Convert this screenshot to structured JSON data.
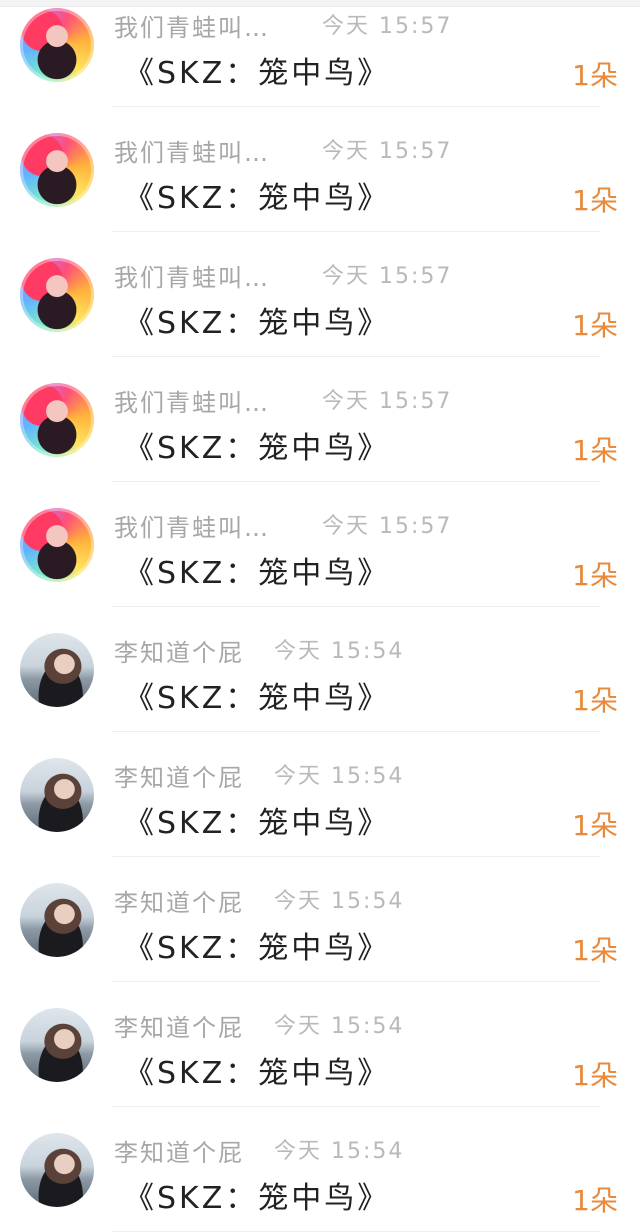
{
  "gift_list": {
    "rows": [
      {
        "name": "我们青蛙叫…",
        "time": "今天 15:57",
        "gift": "《SKZ：笼中鸟》",
        "count": "1朵"
      },
      {
        "name": "我们青蛙叫…",
        "time": "今天 15:57",
        "gift": "《SKZ：笼中鸟》",
        "count": "1朵"
      },
      {
        "name": "我们青蛙叫…",
        "time": "今天 15:57",
        "gift": "《SKZ：笼中鸟》",
        "count": "1朵"
      },
      {
        "name": "我们青蛙叫…",
        "time": "今天 15:57",
        "gift": "《SKZ：笼中鸟》",
        "count": "1朵"
      },
      {
        "name": "我们青蛙叫…",
        "time": "今天 15:57",
        "gift": "《SKZ：笼中鸟》",
        "count": "1朵"
      },
      {
        "name": "李知道个屁",
        "time": "今天 15:54",
        "gift": "《SKZ：笼中鸟》",
        "count": "1朵"
      },
      {
        "name": "李知道个屁",
        "time": "今天 15:54",
        "gift": "《SKZ：笼中鸟》",
        "count": "1朵"
      },
      {
        "name": "李知道个屁",
        "time": "今天 15:54",
        "gift": "《SKZ：笼中鸟》",
        "count": "1朵"
      },
      {
        "name": "李知道个屁",
        "time": "今天 15:54",
        "gift": "《SKZ：笼中鸟》",
        "count": "1朵"
      },
      {
        "name": "李知道个屁",
        "time": "今天 15:54",
        "gift": "《SKZ：笼中鸟》",
        "count": "1朵"
      }
    ]
  },
  "colors": {
    "name": "#a7a7a7",
    "time": "#b9b9b9",
    "gift": "#222222",
    "count": "#e88a3c"
  }
}
